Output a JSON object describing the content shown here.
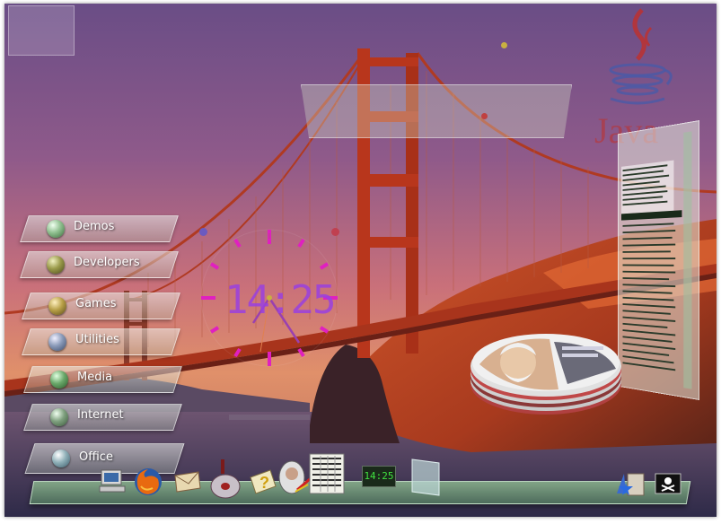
{
  "menu": {
    "items": [
      {
        "label": "Demos",
        "orb": "#8fbf8f"
      },
      {
        "label": "Developers",
        "orb": "#9a9a4a"
      },
      {
        "label": "Games",
        "orb": "#b8a048"
      },
      {
        "label": "Utilities",
        "orb": "#8a9ab8"
      },
      {
        "label": "Media",
        "orb": "#6aa86a"
      },
      {
        "label": "Internet",
        "orb": "#7fa07f"
      },
      {
        "label": "Office",
        "orb": "#8fb0b8"
      }
    ]
  },
  "clock": {
    "time_display": "14:25"
  },
  "java_logo": {
    "text": "Java"
  },
  "dock": {
    "mini_clock": "14:25",
    "icons": [
      "computer-icon",
      "firefox-icon",
      "mail-icon",
      "cd-player-icon",
      "help-icon",
      "photo-icon",
      "calendar-icon",
      "mini-clock-icon",
      "blank-window-icon"
    ],
    "tray_icons": [
      "file-manager-icon",
      "pirate-flag-icon"
    ]
  },
  "colors": {
    "dock": "#8ec48e",
    "clock_ticks": "#e020c0",
    "bridge": "#b8361c"
  }
}
